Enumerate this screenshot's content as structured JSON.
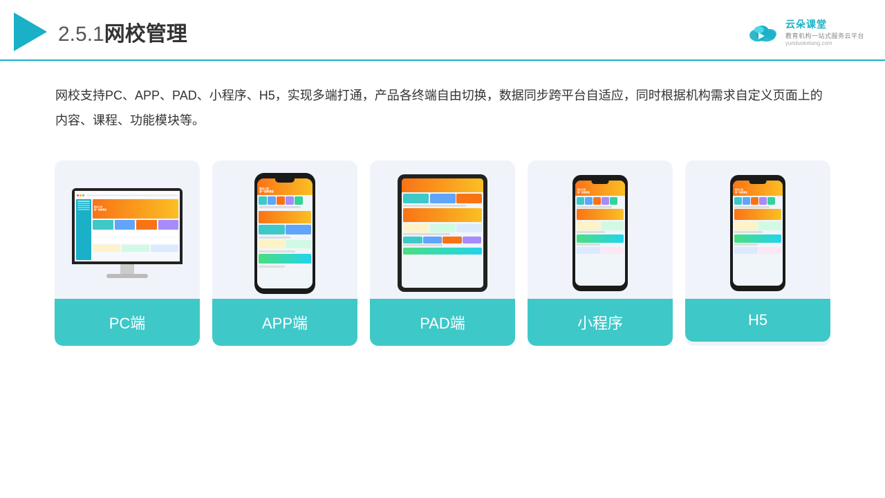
{
  "header": {
    "title_number": "2.5.1",
    "title_bold": "网校管理",
    "logo_main": "云朵课堂",
    "logo_sub": "教育机构一站式服务云平台",
    "logo_url": "yunduoketang.com"
  },
  "description": {
    "text": "网校支持PC、APP、PAD、小程序、H5，实现多端打通，产品各终端自由切换，数据同步跨平台自适应，同时根据机构需求自定义页面上的内容、课程、功能模块等。"
  },
  "cards": [
    {
      "label": "PC端",
      "type": "pc"
    },
    {
      "label": "APP端",
      "type": "phone"
    },
    {
      "label": "PAD端",
      "type": "tablet"
    },
    {
      "label": "小程序",
      "type": "phone2"
    },
    {
      "label": "H5",
      "type": "phone3"
    }
  ],
  "colors": {
    "teal": "#3ec8c8",
    "teal_light": "#4dd0d0",
    "orange": "#f97316",
    "blue_bg": "#f0f4fa",
    "header_line": "#1ab0c8"
  }
}
